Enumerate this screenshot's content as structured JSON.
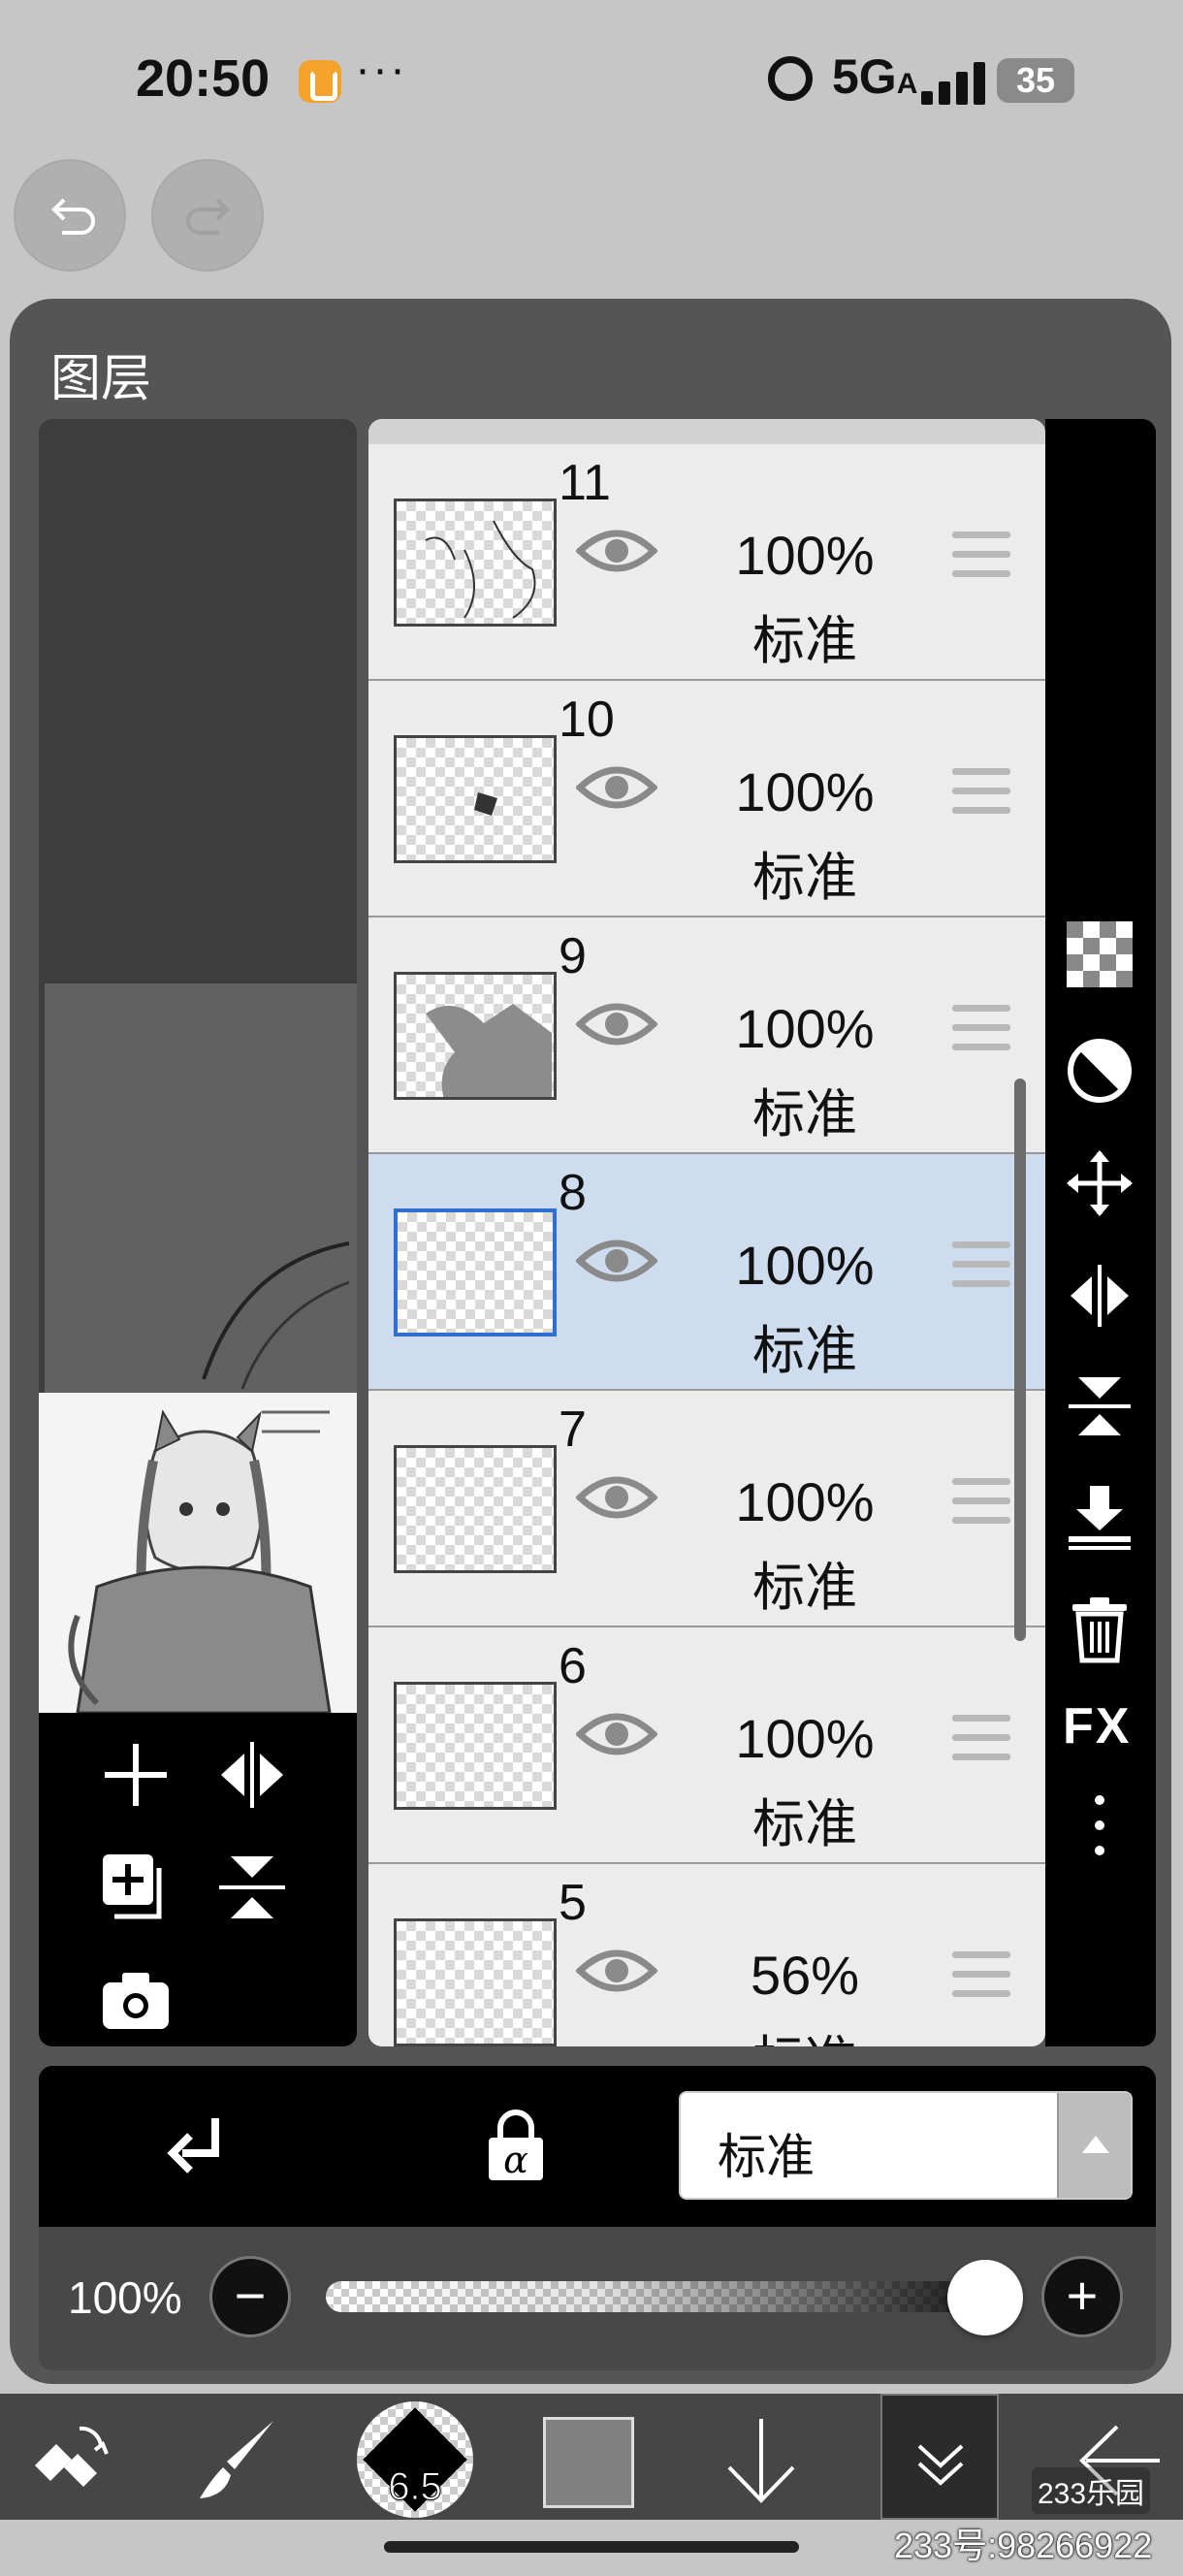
{
  "status_bar": {
    "time": "20:50",
    "dots": "···",
    "network": "5G",
    "network_suffix": "A",
    "battery": "35"
  },
  "panel": {
    "title": "图层"
  },
  "layers": [
    {
      "number": "11",
      "opacity": "100%",
      "mode": "标准",
      "selected": false
    },
    {
      "number": "10",
      "opacity": "100%",
      "mode": "标准",
      "selected": false
    },
    {
      "number": "9",
      "opacity": "100%",
      "mode": "标准",
      "selected": false
    },
    {
      "number": "8",
      "opacity": "100%",
      "mode": "标准",
      "selected": true
    },
    {
      "number": "7",
      "opacity": "100%",
      "mode": "标准",
      "selected": false
    },
    {
      "number": "6",
      "opacity": "100%",
      "mode": "标准",
      "selected": false
    },
    {
      "number": "5",
      "opacity": "56%",
      "mode": "标准",
      "selected": false
    }
  ],
  "tools": {
    "fx_label": "FX"
  },
  "blend": {
    "mode_label": "标准"
  },
  "opacity": {
    "label": "100%",
    "value": 1.0,
    "minus": "−",
    "plus": "+"
  },
  "bottom_bar": {
    "brush_size": "6.5",
    "color": "#808080"
  },
  "watermark": {
    "logo": "233乐园",
    "id": "233号:98266922"
  },
  "icons": {
    "undo": "undo-icon",
    "redo": "redo-icon",
    "eye": "eye-icon",
    "drag": "drag-handle-icon"
  }
}
